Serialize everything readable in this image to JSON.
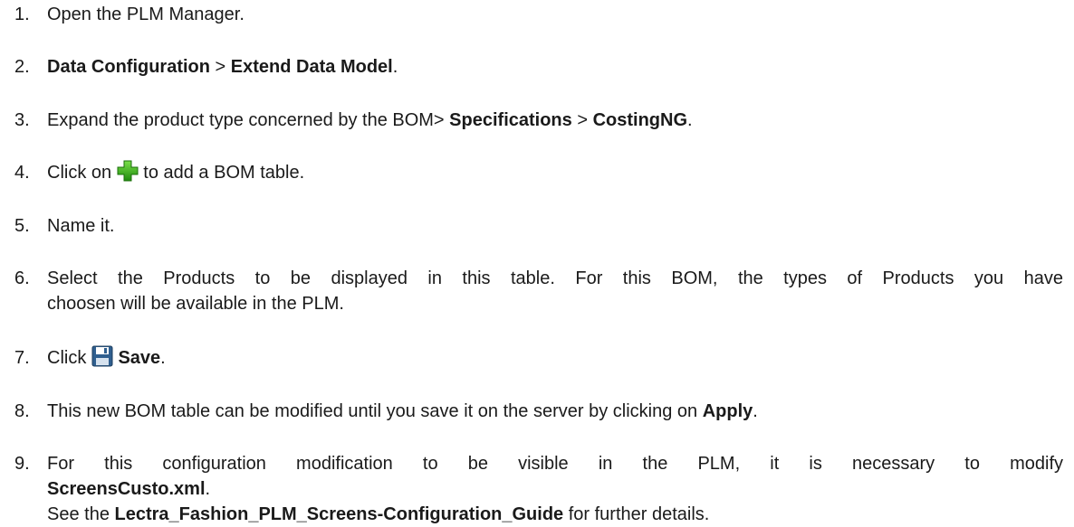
{
  "steps": [
    {
      "number": "1.",
      "parts": {
        "t1": "Open the PLM Manager."
      }
    },
    {
      "number": "2.",
      "parts": {
        "b1": "Data Configuration",
        "t1": " > ",
        "b2": "Extend Data Model",
        "t2": "."
      }
    },
    {
      "number": "3.",
      "parts": {
        "t1": "Expand the product type concerned by the BOM> ",
        "b1": "Specifications",
        "t2": " > ",
        "b2": "CostingNG",
        "t3": "."
      }
    },
    {
      "number": "4.",
      "parts": {
        "t1": "Click on ",
        "icon": "add-plus-icon",
        "t2": " to add a BOM table."
      }
    },
    {
      "number": "5.",
      "parts": {
        "t1": "Name it."
      }
    },
    {
      "number": "6.",
      "parts": {
        "line1": "Select the Products to be displayed in this table. For this BOM, the types of Products you have",
        "line2": "choosen will be available in the PLM."
      }
    },
    {
      "number": "7.",
      "parts": {
        "t1": "Click ",
        "icon": "save-floppy-icon",
        "b1": "Save",
        "t2": "."
      }
    },
    {
      "number": "8.",
      "parts": {
        "t1": "This new BOM table can be modified until you save it on the server by clicking on ",
        "b1": "Apply",
        "t2": "."
      }
    },
    {
      "number": "9.",
      "parts": {
        "line1": "For this configuration modification to be visible in the PLM, it is necessary to modify",
        "b1": "ScreensCusto.xml",
        "t1": ".",
        "t2": "See the ",
        "b2": "Lectra_Fashion_PLM_Screens-Configuration_Guide",
        "t3": " for further details."
      }
    }
  ],
  "colors": {
    "text": "#1a1a1a",
    "plus_green": "#3fbf1f",
    "plus_green_dark": "#1e8a0c",
    "floppy_blue": "#2f5f8f"
  }
}
